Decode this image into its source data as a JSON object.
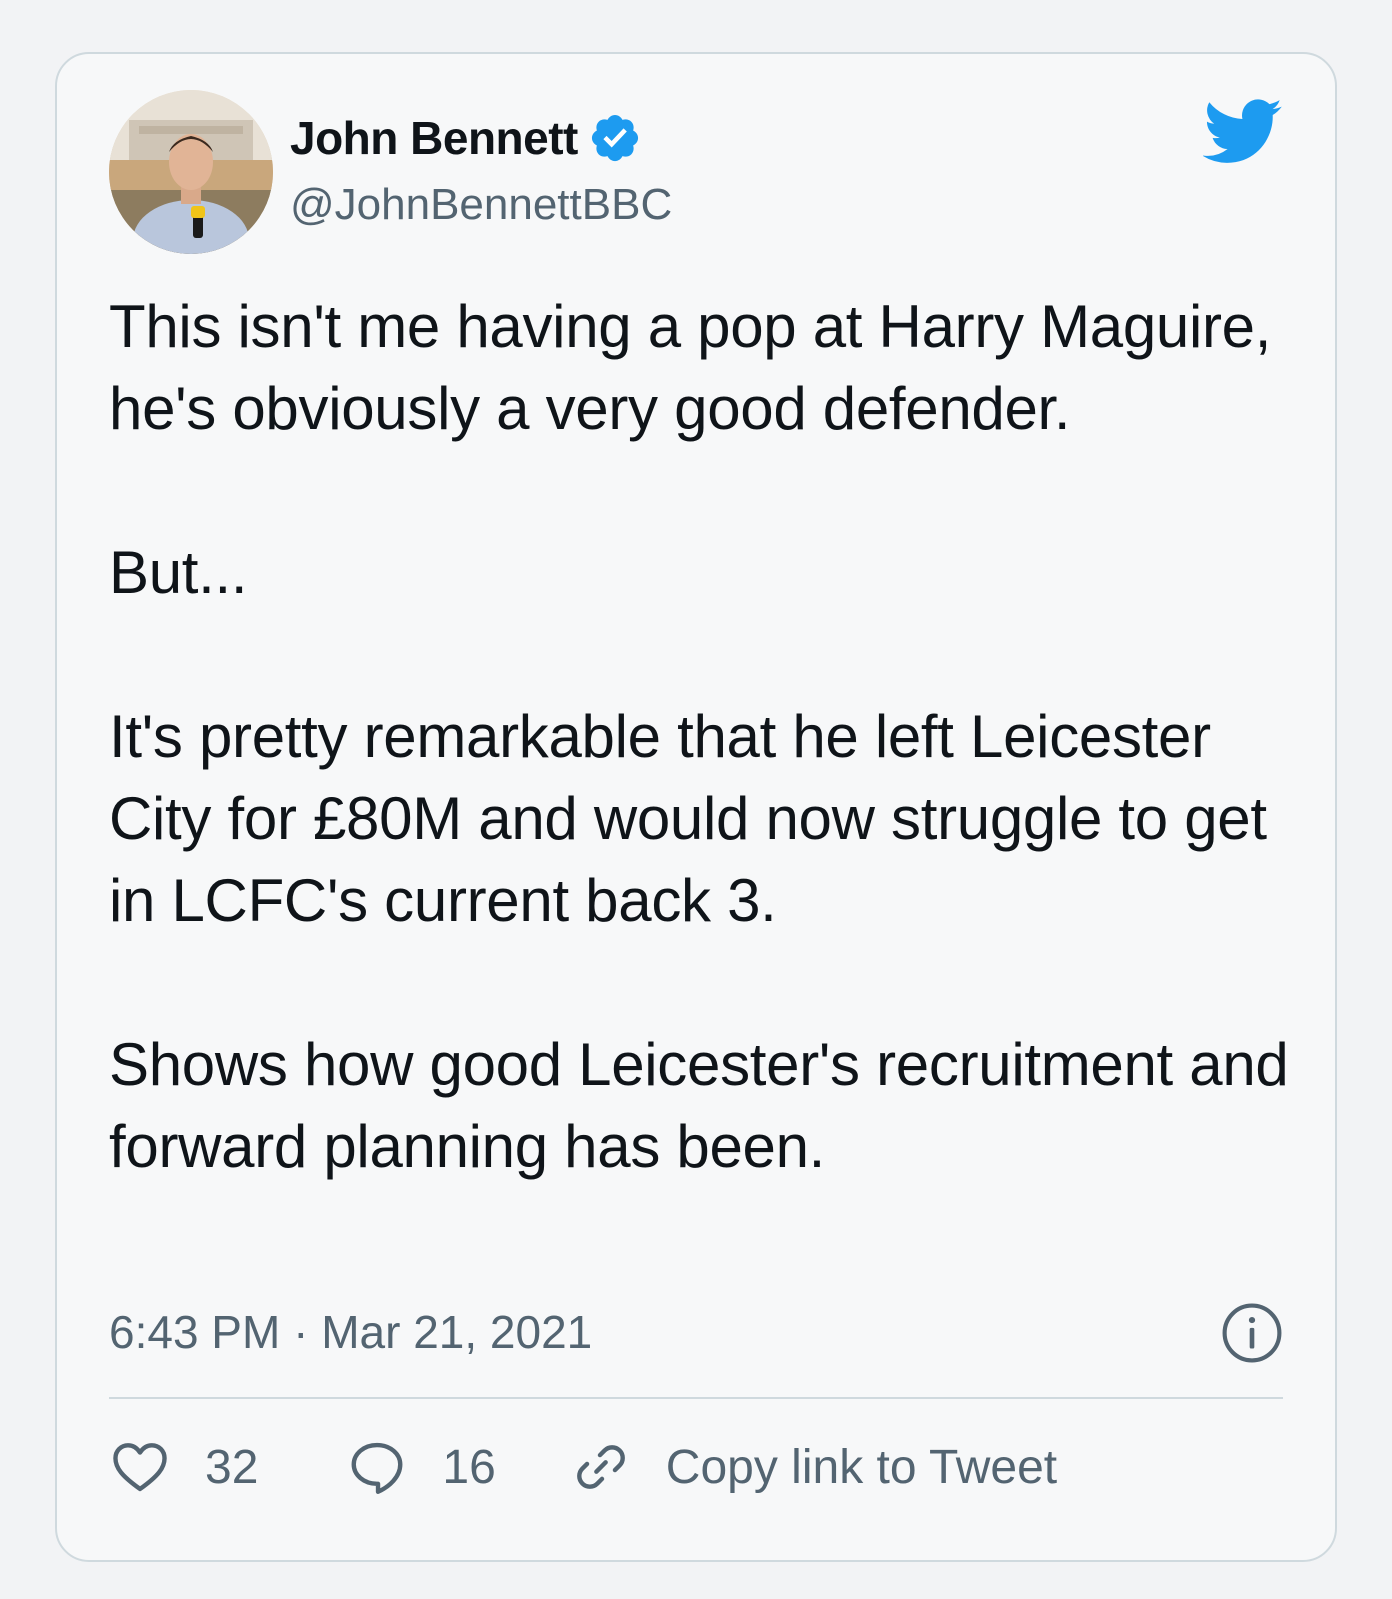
{
  "author": {
    "display_name": "John Bennett",
    "handle": "@JohnBennettBBC",
    "verified": true
  },
  "tweet": {
    "text": "This isn't me having a pop at Harry Maguire, he's obviously a very good defender.\n\nBut...\n\nIt's pretty remarkable that he left Leicester City for £80M and would now struggle to get in LCFC's current back 3.\n\nShows how good Leicester's recruitment and forward planning has been.",
    "timestamp": "6:43 PM · Mar 21, 2021"
  },
  "actions": {
    "likes": "32",
    "replies": "16",
    "copy_link_label": "Copy link to Tweet"
  },
  "icons": {
    "brand": "twitter-bird-icon",
    "verified": "verified-badge-icon",
    "info": "info-icon",
    "like": "heart-icon",
    "reply": "reply-bubble-icon",
    "copy": "link-icon"
  },
  "colors": {
    "brand_blue": "#1d9bf0",
    "text": "#0f1419",
    "muted": "#536471",
    "border": "#cfd9de"
  }
}
